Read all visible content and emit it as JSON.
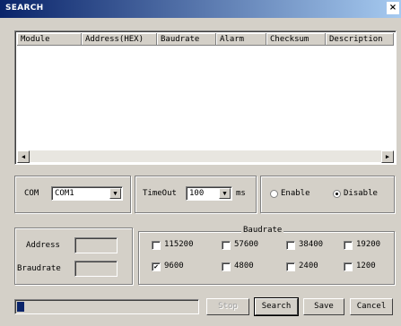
{
  "window": {
    "title": "SEARCH",
    "close_glyph": "×"
  },
  "list": {
    "columns": [
      "Module",
      "Address(HEX)",
      "Baudrate",
      "Alarm",
      "Checksum",
      "Description"
    ],
    "rows": []
  },
  "com": {
    "label": "COM",
    "value": "COM1"
  },
  "timeout": {
    "label": "TimeOut",
    "value": "100",
    "unit": "ms"
  },
  "checksum_mode": {
    "enable_label": "Enable",
    "disable_label": "Disable",
    "selected": "Disable"
  },
  "address": {
    "label": "Address",
    "value": ""
  },
  "braudrate": {
    "label": "Braudrate",
    "value": ""
  },
  "baudrate": {
    "title": "Baudrate",
    "options": [
      {
        "label": "115200",
        "checked": false
      },
      {
        "label": "57600",
        "checked": false
      },
      {
        "label": "38400",
        "checked": false
      },
      {
        "label": "19200",
        "checked": false
      },
      {
        "label": "9600",
        "checked": true
      },
      {
        "label": "4800",
        "checked": false
      },
      {
        "label": "2400",
        "checked": false
      },
      {
        "label": "1200",
        "checked": false
      }
    ]
  },
  "progress": {
    "percent": 4
  },
  "buttons": {
    "stop": "Stop",
    "search": "Search",
    "save": "Save",
    "cancel": "Cancel"
  },
  "icons": {
    "scroll_left": "left-arrow-icon",
    "scroll_right": "right-arrow-icon",
    "dropdown": "chevron-down-icon"
  }
}
